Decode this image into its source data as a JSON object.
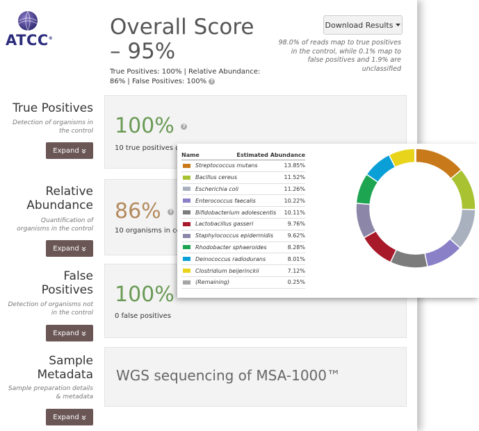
{
  "brand": {
    "name": "ATCC",
    "mark": "®"
  },
  "header": {
    "title": "Overall Score – 95%",
    "subtitle": "True Positives: 100% | Relative Abundance: 86% | False Positives: 100%",
    "download_label": "Download Results",
    "note": "98.0% of reads map to true positives in the control, while 0.1% map to false positives and 1.9% are unclassified"
  },
  "sections": [
    {
      "title": "True Positives",
      "description": "Detection of organisms in the control",
      "expand_label": "Expand",
      "score": "100%",
      "detail": "10 true positives detected in the control"
    },
    {
      "title": "Relative Abundance",
      "description": "Quantification of organisms in the control",
      "expand_label": "Expand",
      "score": "86%",
      "detail": "10 organisms in control"
    },
    {
      "title": "False Positives",
      "description": "Detection of organisms not in the control",
      "expand_label": "Expand",
      "score": "100%",
      "detail": "0 false positives"
    },
    {
      "title": "Sample Metadata",
      "description": "Sample preparation details & metadata",
      "expand_label": "Expand",
      "detail": "WGS sequencing of MSA-1000™"
    }
  ],
  "abundance_table": {
    "col_name": "Name",
    "col_value": "Estimated Abundance",
    "rows": [
      {
        "name": "Streptococcus mutans",
        "value": "13.85%",
        "color": "#c87a1a"
      },
      {
        "name": "Bacillus cereus",
        "value": "11.52%",
        "color": "#a8c232"
      },
      {
        "name": "Escherichia coli",
        "value": "11.26%",
        "color": "#a9b1bf"
      },
      {
        "name": "Enterococcus faecalis",
        "value": "10.22%",
        "color": "#8a80c8"
      },
      {
        "name": "Bifidobacterium adolescentis",
        "value": "10.11%",
        "color": "#7c7c7c"
      },
      {
        "name": "Lactobacillus gasseri",
        "value": "9.76%",
        "color": "#a8192a"
      },
      {
        "name": "Staphylococcus epidermidis",
        "value": "9.62%",
        "color": "#8c87a8"
      },
      {
        "name": "Rhodobacter sphaeroides",
        "value": "8.28%",
        "color": "#1ea551"
      },
      {
        "name": "Deinococcus radiodurans",
        "value": "8.01%",
        "color": "#0a9fd6"
      },
      {
        "name": "Clostridium beijerinckii",
        "value": "7.12%",
        "color": "#e8d41a"
      },
      {
        "name": "(Remaining)",
        "value": "0.25%",
        "color": "#a5a5a5"
      }
    ]
  },
  "colors": {
    "expand_button": "#6b5656",
    "score_green": "#6a9a55",
    "score_tan": "#b38a5e",
    "brand": "#2c2c7c"
  },
  "icons": {
    "download_caret": "caret-down-icon",
    "expand_chevron": "chevron-down-icon",
    "help": "question-icon"
  }
}
